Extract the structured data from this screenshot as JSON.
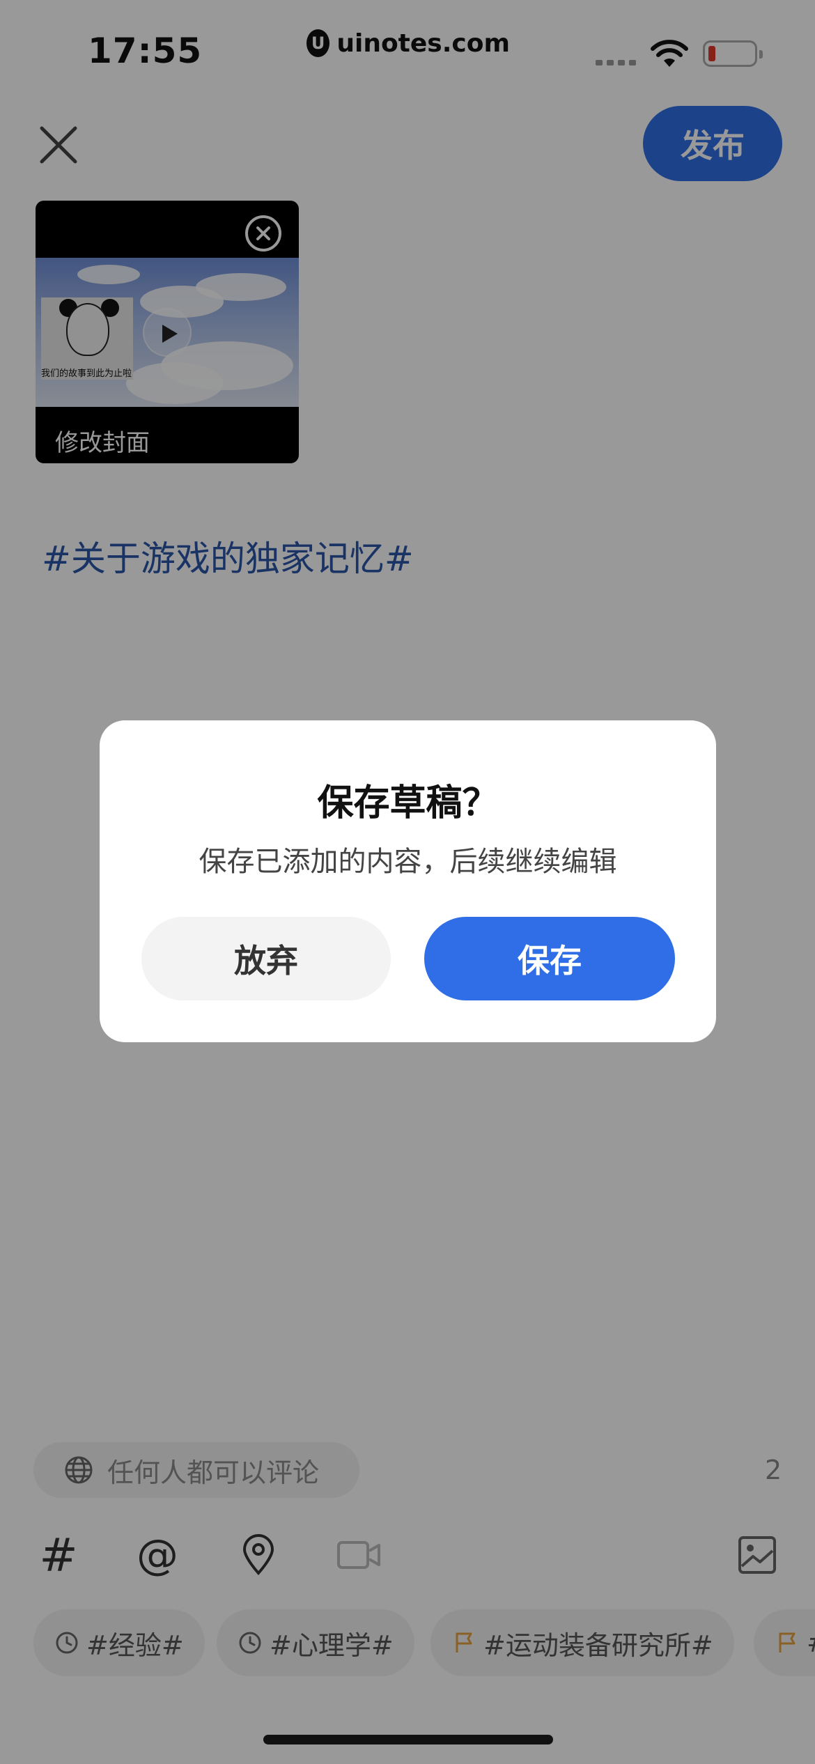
{
  "status_bar": {
    "time": "17:55",
    "watermark": "uinotes.com",
    "watermark_logo": "U",
    "battery_color": "#e03a2b"
  },
  "header": {
    "publish_label": "发布",
    "accent_color": "#2f6ee6"
  },
  "video": {
    "cover_label": "修改封面",
    "meme_caption": "我们的故事到此为止啦"
  },
  "post": {
    "hashtag_text": "#关于游戏的独家记忆#"
  },
  "comment_setting": {
    "label": "任何人都可以评论",
    "count": "2"
  },
  "toolbar": {
    "hash_symbol": "#",
    "at_symbol": "@",
    "icons": [
      "hash-icon",
      "at-icon",
      "location-icon",
      "video-icon",
      "image-icon"
    ]
  },
  "topic_chips": [
    {
      "label": "#经验#",
      "icon": "clock-icon"
    },
    {
      "label": "#心理学#",
      "icon": "clock-icon"
    },
    {
      "label": "#运动装备研究所#",
      "icon": "flag-icon"
    },
    {
      "label": "#",
      "icon": "flag-icon"
    }
  ],
  "dialog": {
    "title": "保存草稿？",
    "message": "保存已添加的内容，后续继续编辑",
    "discard_label": "放弃",
    "save_label": "保存"
  }
}
